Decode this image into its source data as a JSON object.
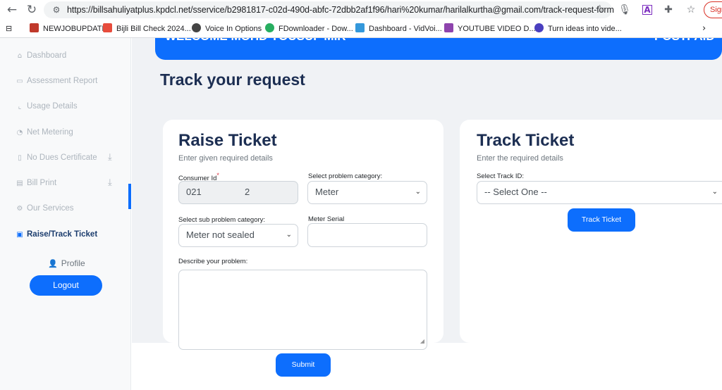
{
  "browser": {
    "url": "https://billsahuliyatplus.kpdcl.net/sservice/b2981817-c02d-490d-abfc-72dbb2af1f96/hari%20kumar/harilalkurtha@gmail.com/track-request-form",
    "sign_label": "Sign",
    "bookmarks": [
      {
        "label": "NEWJOBUPDATE",
        "color": "#c0392b"
      },
      {
        "label": "Bijli Bill Check 2024...",
        "color": "#e74c3c"
      },
      {
        "label": "Voice In Options",
        "color": "#444444"
      },
      {
        "label": "FDownloader - Dow...",
        "color": "#27ae60"
      },
      {
        "label": "Dashboard - VidVoi...",
        "color": "#3498db"
      },
      {
        "label": "YOUTUBE VIDEO D...",
        "color": "#8e44ad"
      },
      {
        "label": "Turn ideas into vide...",
        "color": "#4a3fbf"
      }
    ]
  },
  "sidebar": {
    "items": [
      {
        "label": "Dashboard",
        "icon": "home-icon"
      },
      {
        "label": "Assessment Report",
        "icon": "report-icon"
      },
      {
        "label": "Usage Details",
        "icon": "chart-icon"
      },
      {
        "label": "Net Metering",
        "icon": "gauge-icon"
      },
      {
        "label": "No Dues Certificate",
        "icon": "file-icon"
      },
      {
        "label": "Bill Print",
        "icon": "document-icon"
      },
      {
        "label": "Our Services",
        "icon": "gears-icon"
      },
      {
        "label": "Raise/Track Ticket",
        "icon": "ticket-icon",
        "active": true
      }
    ],
    "profile_label": "Profile",
    "logout_label": "Logout"
  },
  "banner": {
    "welcome": "WELCOME MOHD YOUSUF MIR",
    "plan": "POSTPAID"
  },
  "page_title": "Track your request",
  "raise": {
    "title": "Raise Ticket",
    "subtitle": "Enter given required details",
    "consumer_label": "Consumer Id",
    "consumer_value_start": "021",
    "consumer_value_end": "2",
    "category_label": "Select problem category:",
    "category_value": "Meter",
    "subcategory_label": "Select sub problem category:",
    "subcategory_value": "Meter not sealed",
    "serial_label": "Meter Serial",
    "serial_value": "",
    "describe_label": "Describe your problem:",
    "describe_value": "",
    "submit_label": "Submit"
  },
  "track": {
    "title": "Track Ticket",
    "subtitle": "Enter the required details",
    "track_id_label": "Select Track ID:",
    "track_id_value": "-- Select One --",
    "button_label": "Track Ticket"
  },
  "colors": {
    "accent": "#0d6efd",
    "heading": "#1c2e52",
    "background": "#f0f2f5"
  }
}
